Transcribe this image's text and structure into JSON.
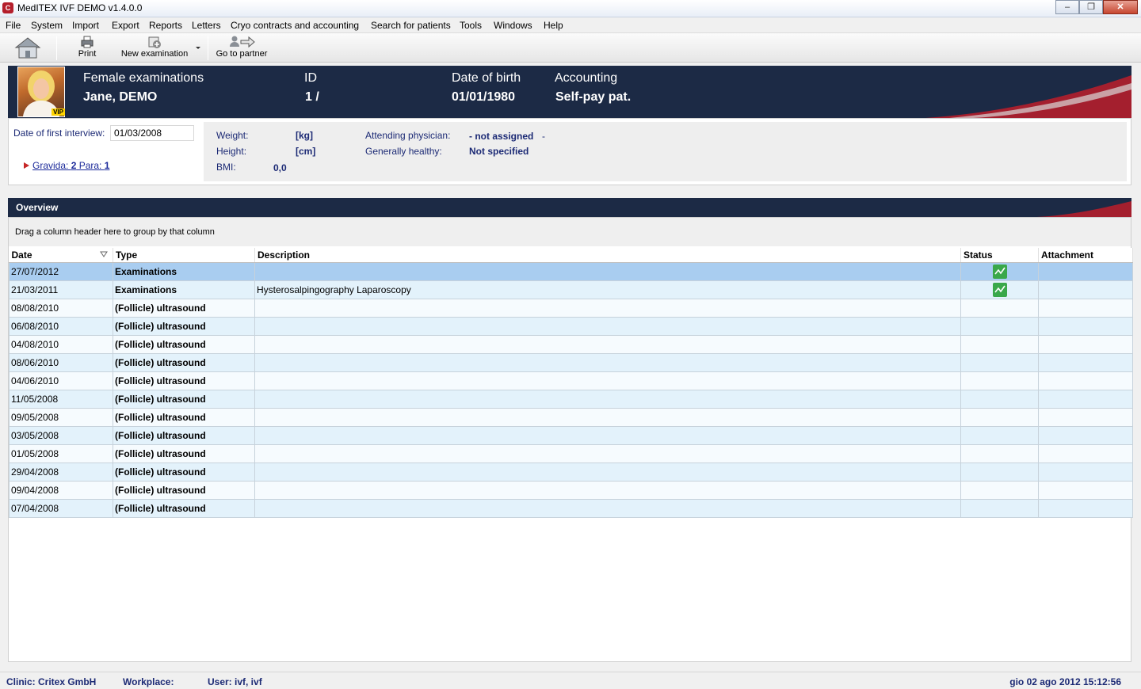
{
  "window": {
    "title": "MedITEX IVF DEMO v1.4.0.0"
  },
  "menu": [
    "File",
    "System",
    "Import",
    "Export",
    "Reports",
    "Letters",
    "Cryo contracts and accounting",
    "Search for patients",
    "Tools",
    "Windows",
    "Help"
  ],
  "toolbar": {
    "home_icon": "home-icon",
    "print_label": "Print",
    "new_exam_label": "New examination",
    "partner_label": "Go to partner"
  },
  "patient": {
    "section_label": "Female examinations",
    "name": "Jane, DEMO",
    "id_label": "ID",
    "id_value": "1 /",
    "dob_label": "Date of birth",
    "dob_value": "01/01/1980",
    "accounting_label": "Accounting",
    "accounting_value": "Self-pay pat.",
    "vip_badge": "VIP"
  },
  "info": {
    "first_interview_label": "Date of first interview:",
    "first_interview_value": "01/03/2008",
    "gravida_text": "Gravida: ",
    "gravida_value": "2",
    "para_text": " Para: ",
    "para_value": "1",
    "weight_label": "Weight:",
    "weight_unit": "[kg]",
    "height_label": "Height:",
    "height_unit": "[cm]",
    "bmi_label": "BMI:",
    "bmi_value": "0,0",
    "physician_label": "Attending physician:",
    "physician_value": "- not assigned",
    "physician_suffix": "-",
    "healthy_label": "Generally healthy:",
    "healthy_value": "Not specified"
  },
  "overview": {
    "title": "Overview",
    "group_hint": "Drag a column header here to group by that column",
    "columns": [
      "Date",
      "Type",
      "Description",
      "Status",
      "Attachment"
    ],
    "rows": [
      {
        "date": "27/07/2012",
        "type": "Examinations",
        "description": "",
        "status": true
      },
      {
        "date": "21/03/2011",
        "type": "Examinations",
        "description": "Hysterosalpingography  Laparoscopy",
        "status": true
      },
      {
        "date": "08/08/2010",
        "type": "(Follicle) ultrasound",
        "description": "",
        "status": false
      },
      {
        "date": "06/08/2010",
        "type": "(Follicle) ultrasound",
        "description": "",
        "status": false
      },
      {
        "date": "04/08/2010",
        "type": "(Follicle) ultrasound",
        "description": "",
        "status": false
      },
      {
        "date": "08/06/2010",
        "type": "(Follicle) ultrasound",
        "description": "",
        "status": false
      },
      {
        "date": "04/06/2010",
        "type": "(Follicle) ultrasound",
        "description": "",
        "status": false
      },
      {
        "date": "11/05/2008",
        "type": "(Follicle) ultrasound",
        "description": "",
        "status": false
      },
      {
        "date": "09/05/2008",
        "type": "(Follicle) ultrasound",
        "description": "",
        "status": false
      },
      {
        "date": "03/05/2008",
        "type": "(Follicle) ultrasound",
        "description": "",
        "status": false
      },
      {
        "date": "01/05/2008",
        "type": "(Follicle) ultrasound",
        "description": "",
        "status": false
      },
      {
        "date": "29/04/2008",
        "type": "(Follicle) ultrasound",
        "description": "",
        "status": false
      },
      {
        "date": "09/04/2008",
        "type": "(Follicle) ultrasound",
        "description": "",
        "status": false
      },
      {
        "date": "07/04/2008",
        "type": "(Follicle) ultrasound",
        "description": "",
        "status": false
      }
    ]
  },
  "statusbar": {
    "clinic": "Clinic: Critex GmbH",
    "workplace": "Workplace:",
    "user": "User: ivf, ivf",
    "datetime": "gio 02 ago 2012 15:12:56"
  },
  "colors": {
    "header_navy": "#1c2a45",
    "accent_red": "#b41e2b",
    "link_blue": "#1c2a9a",
    "row_alt": "#e3f2fb",
    "row_selected": "#a9cdf0",
    "status_green": "#3aa84a"
  }
}
